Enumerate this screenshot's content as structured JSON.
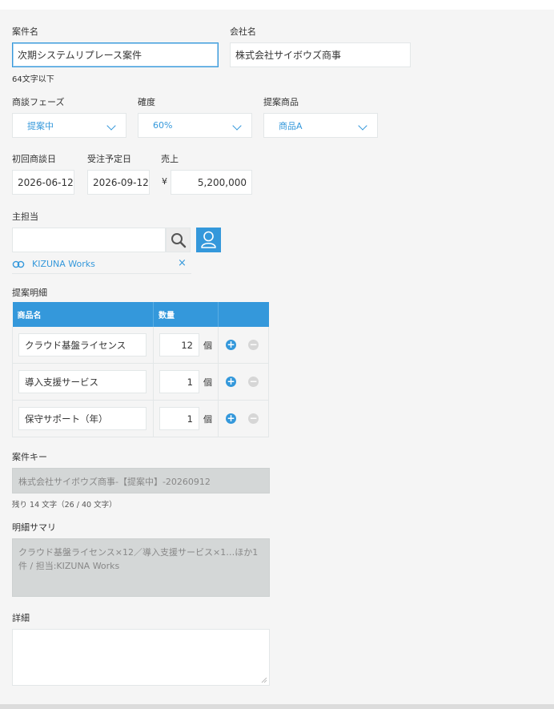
{
  "fields": {
    "deal_name": {
      "label": "案件名",
      "value": "次期システムリプレース案件",
      "hint": "64文字以下"
    },
    "company": {
      "label": "会社名",
      "value": "株式会社サイボウズ商事"
    },
    "phase": {
      "label": "商談フェーズ",
      "value": "提案中"
    },
    "certainty": {
      "label": "確度",
      "value": "60%"
    },
    "product": {
      "label": "提案商品",
      "value": "商品A"
    },
    "first_meeting": {
      "label": "初回商談日",
      "value": "2026-06-12"
    },
    "order_date": {
      "label": "受注予定日",
      "value": "2026-09-12"
    },
    "sales": {
      "label": "売上",
      "currency": "¥",
      "value": "5,200,000"
    },
    "owner": {
      "label": "主担当",
      "input_value": "",
      "selected_user": "KIZUNA Works"
    },
    "detail_table": {
      "label": "提案明細",
      "headers": [
        "商品名",
        "数量"
      ],
      "rows": [
        {
          "name": "クラウド基盤ライセンス",
          "qty": "12",
          "unit": "個"
        },
        {
          "name": "導入支援サービス",
          "qty": "1",
          "unit": "個"
        },
        {
          "name": "保守サポート（年）",
          "qty": "1",
          "unit": "個"
        }
      ]
    },
    "deal_key": {
      "label": "案件キー",
      "value": "株式会社サイボウズ商事-【提案中】-20260912",
      "hint": "残り 14 文字（26 / 40 文字）"
    },
    "summary": {
      "label": "明細サマリ",
      "value": "クラウド基盤ライセンス×12／導入支援サービス×1…ほか1件 / 担当:KIZUNA Works"
    },
    "details": {
      "label": "詳細",
      "value": ""
    }
  },
  "colors": {
    "accent": "#3498db",
    "readonly_bg": "#d4d7d7"
  },
  "icons": {
    "search": "search-icon",
    "user_picker": "user-icon",
    "org": "organization-icon",
    "remove": "close-icon"
  }
}
